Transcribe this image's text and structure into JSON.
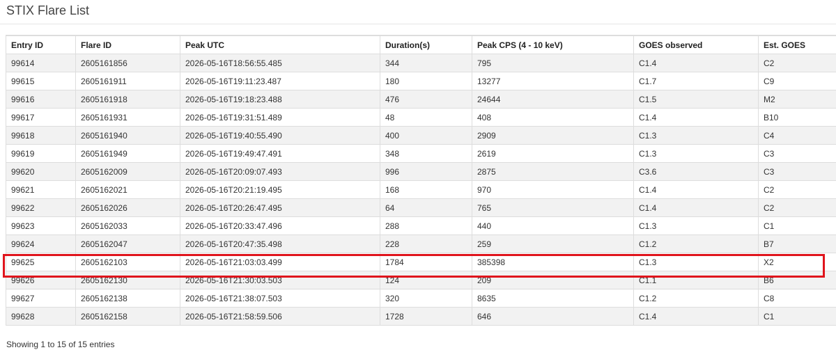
{
  "page": {
    "title": "STIX Flare List"
  },
  "table": {
    "columns": [
      "Entry ID",
      "Flare ID",
      "Peak UTC",
      "Duration(s)",
      "Peak CPS (4 - 10 keV)",
      "GOES observed",
      "Est. GOES"
    ],
    "rows": [
      [
        "99614",
        "2605161856",
        "2026-05-16T18:56:55.485",
        "344",
        "795",
        "C1.4",
        "C2"
      ],
      [
        "99615",
        "2605161911",
        "2026-05-16T19:11:23.487",
        "180",
        "13277",
        "C1.7",
        "C9"
      ],
      [
        "99616",
        "2605161918",
        "2026-05-16T19:18:23.488",
        "476",
        "24644",
        "C1.5",
        "M2"
      ],
      [
        "99617",
        "2605161931",
        "2026-05-16T19:31:51.489",
        "48",
        "408",
        "C1.4",
        "B10"
      ],
      [
        "99618",
        "2605161940",
        "2026-05-16T19:40:55.490",
        "400",
        "2909",
        "C1.3",
        "C4"
      ],
      [
        "99619",
        "2605161949",
        "2026-05-16T19:49:47.491",
        "348",
        "2619",
        "C1.3",
        "C3"
      ],
      [
        "99620",
        "2605162009",
        "2026-05-16T20:09:07.493",
        "996",
        "2875",
        "C3.6",
        "C3"
      ],
      [
        "99621",
        "2605162021",
        "2026-05-16T20:21:19.495",
        "168",
        "970",
        "C1.4",
        "C2"
      ],
      [
        "99622",
        "2605162026",
        "2026-05-16T20:26:47.495",
        "64",
        "765",
        "C1.4",
        "C2"
      ],
      [
        "99623",
        "2605162033",
        "2026-05-16T20:33:47.496",
        "288",
        "440",
        "C1.3",
        "C1"
      ],
      [
        "99624",
        "2605162047",
        "2026-05-16T20:47:35.498",
        "228",
        "259",
        "C1.2",
        "B7"
      ],
      [
        "99625",
        "2605162103",
        "2026-05-16T21:03:03.499",
        "1784",
        "385398",
        "C1.3",
        "X2"
      ],
      [
        "99626",
        "2605162130",
        "2026-05-16T21:30:03.503",
        "124",
        "209",
        "C1.1",
        "B6"
      ],
      [
        "99627",
        "2605162138",
        "2026-05-16T21:38:07.503",
        "320",
        "8635",
        "C1.2",
        "C8"
      ],
      [
        "99628",
        "2605162158",
        "2026-05-16T21:58:59.506",
        "1728",
        "646",
        "C1.4",
        "C1"
      ]
    ],
    "highlighted_row": 11
  },
  "footer": {
    "info": "Showing 1 to 15 of 15 entries"
  },
  "colors": {
    "highlight_border": "#e0141c",
    "striped_row": "#f2f2f2",
    "grid_line": "#dddddd"
  }
}
